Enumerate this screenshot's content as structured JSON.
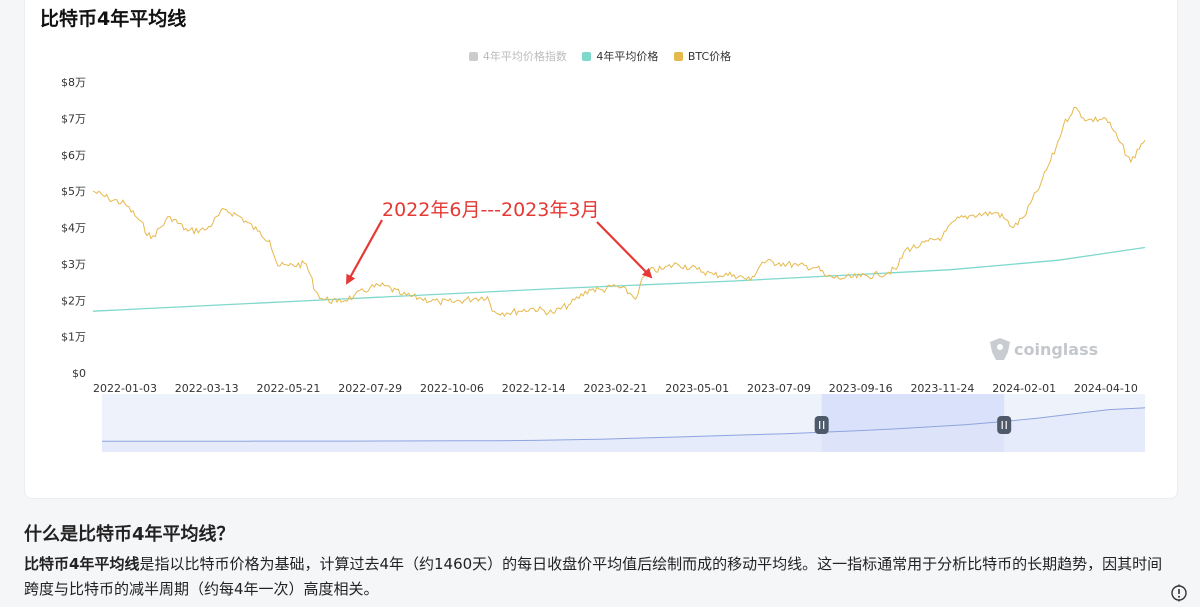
{
  "page": {
    "title": "比特币4年平均线"
  },
  "chart_data": {
    "type": "line",
    "title": "比特币4年平均线",
    "legend": [
      {
        "name": "4年平均价格指数",
        "color": "#cccccc",
        "active": false
      },
      {
        "name": "4年平均价格",
        "color": "#7fd8cc",
        "active": true
      },
      {
        "name": "BTC价格",
        "color": "#e6b94d",
        "active": true
      }
    ],
    "y_ticks": [
      "$0",
      "$1万",
      "$2万",
      "$3万",
      "$4万",
      "$5万",
      "$6万",
      "$7万",
      "$8万"
    ],
    "ylim": [
      0,
      80000
    ],
    "x_ticks": [
      "2022-01-03",
      "2022-03-13",
      "2022-05-21",
      "2022-07-29",
      "2022-10-06",
      "2022-12-14",
      "2023-02-21",
      "2023-05-01",
      "2023-07-09",
      "2023-09-16",
      "2023-11-24",
      "2024-02-01",
      "2024-04-10"
    ],
    "xlim": [
      "2021-12-07",
      "2024-05-13"
    ],
    "series": [
      {
        "name": "BTC价格",
        "color": "#e6b94d",
        "x": [
          "2021-12-07",
          "2021-12-20",
          "2022-01-03",
          "2022-01-15",
          "2022-01-25",
          "2022-02-10",
          "2022-02-25",
          "2022-03-13",
          "2022-03-28",
          "2022-04-10",
          "2022-04-25",
          "2022-05-05",
          "2022-05-12",
          "2022-05-21",
          "2022-06-05",
          "2022-06-13",
          "2022-06-18",
          "2022-07-01",
          "2022-07-15",
          "2022-07-29",
          "2022-08-10",
          "2022-08-25",
          "2022-09-10",
          "2022-09-25",
          "2022-10-06",
          "2022-10-25",
          "2022-11-05",
          "2022-11-09",
          "2022-11-21",
          "2022-12-01",
          "2022-12-14",
          "2022-12-30",
          "2023-01-14",
          "2023-01-30",
          "2023-02-10",
          "2023-02-21",
          "2023-03-05",
          "2023-03-10",
          "2023-03-14",
          "2023-03-20",
          "2023-04-01",
          "2023-04-14",
          "2023-05-01",
          "2023-05-15",
          "2023-06-01",
          "2023-06-15",
          "2023-06-25",
          "2023-07-09",
          "2023-07-25",
          "2023-08-10",
          "2023-08-18",
          "2023-09-01",
          "2023-09-16",
          "2023-10-01",
          "2023-10-16",
          "2023-10-24",
          "2023-11-05",
          "2023-11-24",
          "2023-12-05",
          "2023-12-20",
          "2024-01-10",
          "2024-01-23",
          "2024-02-01",
          "2024-02-15",
          "2024-02-28",
          "2024-03-05",
          "2024-03-14",
          "2024-03-25",
          "2024-04-10",
          "2024-04-20",
          "2024-05-01",
          "2024-05-10",
          "2024-05-13"
        ],
        "values": [
          50000,
          48000,
          46500,
          42000,
          37000,
          43000,
          39000,
          39500,
          45000,
          43000,
          39000,
          36500,
          29500,
          29500,
          30000,
          22500,
          20500,
          19500,
          21000,
          23500,
          24000,
          21500,
          20500,
          19500,
          19500,
          20500,
          21000,
          17000,
          16500,
          17000,
          17800,
          16500,
          19000,
          23000,
          22800,
          24000,
          22000,
          20300,
          24500,
          28000,
          28500,
          30000,
          28500,
          27000,
          27000,
          25500,
          30500,
          30300,
          29500,
          29000,
          26500,
          26000,
          26500,
          27000,
          28500,
          34000,
          35000,
          37500,
          42000,
          43500,
          44000,
          40000,
          43000,
          52000,
          62000,
          68000,
          73000,
          69500,
          70000,
          64500,
          58000,
          63000,
          64000
        ]
      },
      {
        "name": "4年平均价格",
        "color": "#7fd8cc",
        "x": [
          "2021-12-07",
          "2022-06-01",
          "2023-01-01",
          "2023-06-01",
          "2023-12-01",
          "2024-03-01",
          "2024-05-13"
        ],
        "values": [
          17000,
          19800,
          23200,
          25300,
          28400,
          31000,
          34500
        ]
      }
    ],
    "annotations": [
      {
        "text": "2022年6月---2023年3月",
        "color": "#e53935"
      }
    ],
    "watermark": "coinglass",
    "zoom_slider": {
      "start": 0.69,
      "end": 0.865
    }
  },
  "article": {
    "heading": "什么是比特币4年平均线？",
    "term": "比特币4年平均线",
    "body": "是指以比特币价格为基础，计算过去4年（约1460天）的每日收盘价平均值后绘制而成的移动平均线。这一指标通常用于分析比特币的长期趋势，因其时间跨度与比特币的减半周期（约每4年一次）高度相关。"
  }
}
